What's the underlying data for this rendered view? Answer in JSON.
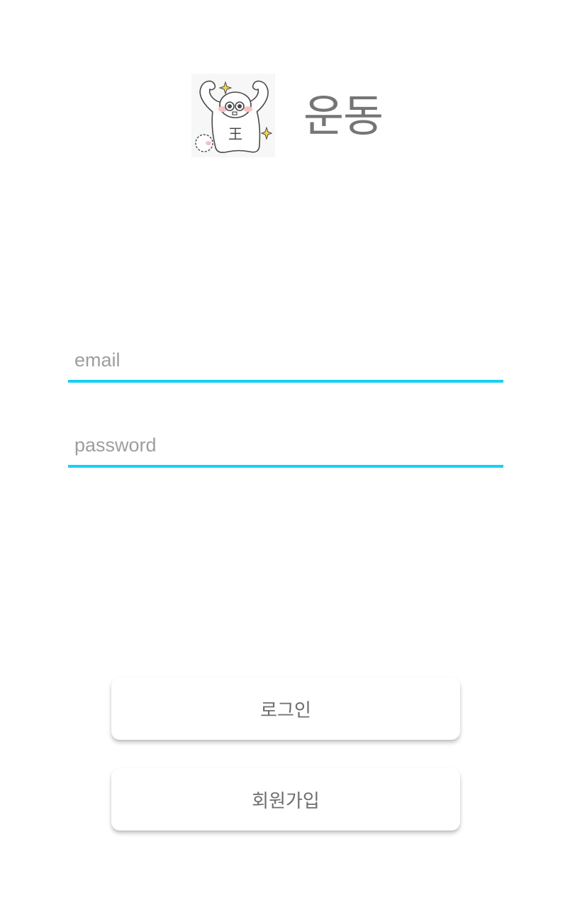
{
  "header": {
    "logo_icon": "muscle-ghost-mascot-icon",
    "logo_text": "王",
    "title": "운동"
  },
  "form": {
    "email_placeholder": "email",
    "email_value": "",
    "password_placeholder": "password",
    "password_value": ""
  },
  "buttons": {
    "login_label": "로그인",
    "signup_label": "회원가입"
  },
  "colors": {
    "accent": "#16d0f4",
    "text_muted": "#757575",
    "placeholder": "#9e9e9e",
    "sparkle": "#f2d54a",
    "blush": "#f4c2c2"
  }
}
